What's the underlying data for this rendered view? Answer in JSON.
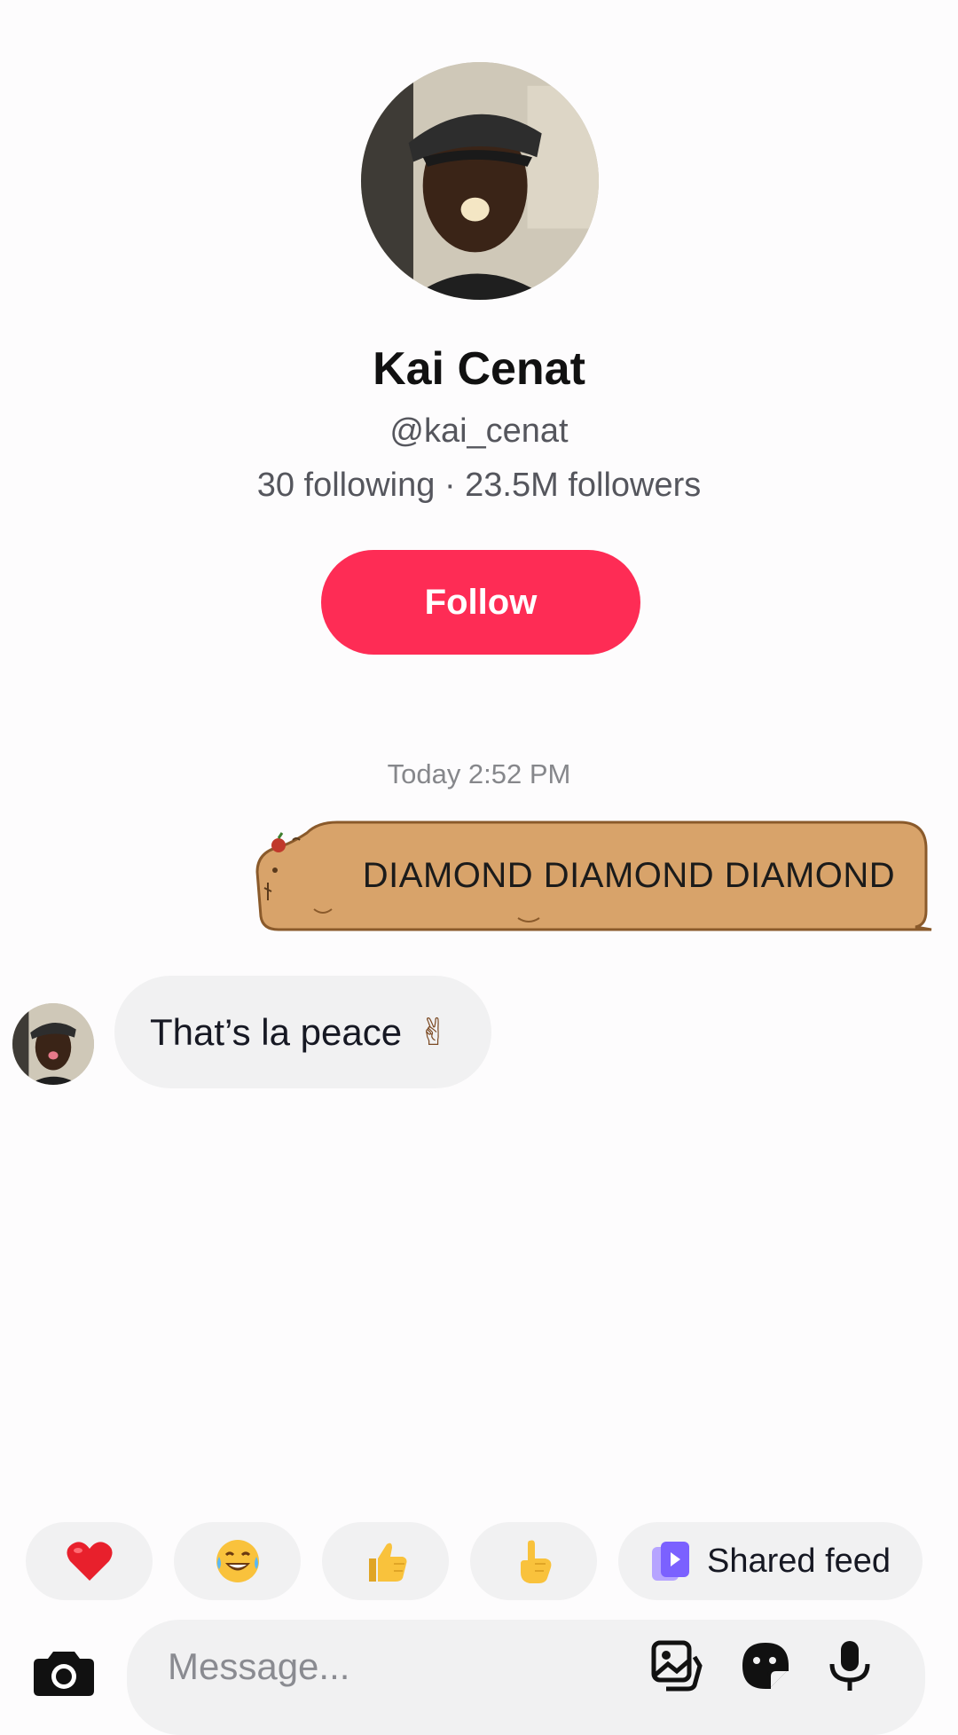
{
  "profile": {
    "name": "Kai Cenat",
    "handle": "@kai_cenat",
    "stats": "30 following · 23.5M followers",
    "follow_label": "Follow"
  },
  "chat": {
    "timestamp": "Today 2:52 PM",
    "messages": [
      {
        "sender": "me",
        "type": "sticker-text",
        "text": "DIAMOND DIAMOND DIAMOND"
      },
      {
        "sender": "them",
        "type": "text",
        "text": "That’s la peace",
        "emoji": "✌"
      }
    ]
  },
  "quick_reactions": [
    {
      "icon": "heart-icon"
    },
    {
      "icon": "laughing-tears-icon"
    },
    {
      "icon": "thumbs-up-icon"
    },
    {
      "icon": "pointing-hand-icon"
    },
    {
      "icon": "shared-feed-icon",
      "label": "Shared feed"
    }
  ],
  "composer": {
    "placeholder": "Message..."
  },
  "colors": {
    "accent": "#fe2c55",
    "sticker_fill": "#d8a36a",
    "sticker_outline": "#8a5a2b",
    "bubble_gray": "#f1f1f2",
    "shared_feed_purple": "#7b61ff"
  }
}
